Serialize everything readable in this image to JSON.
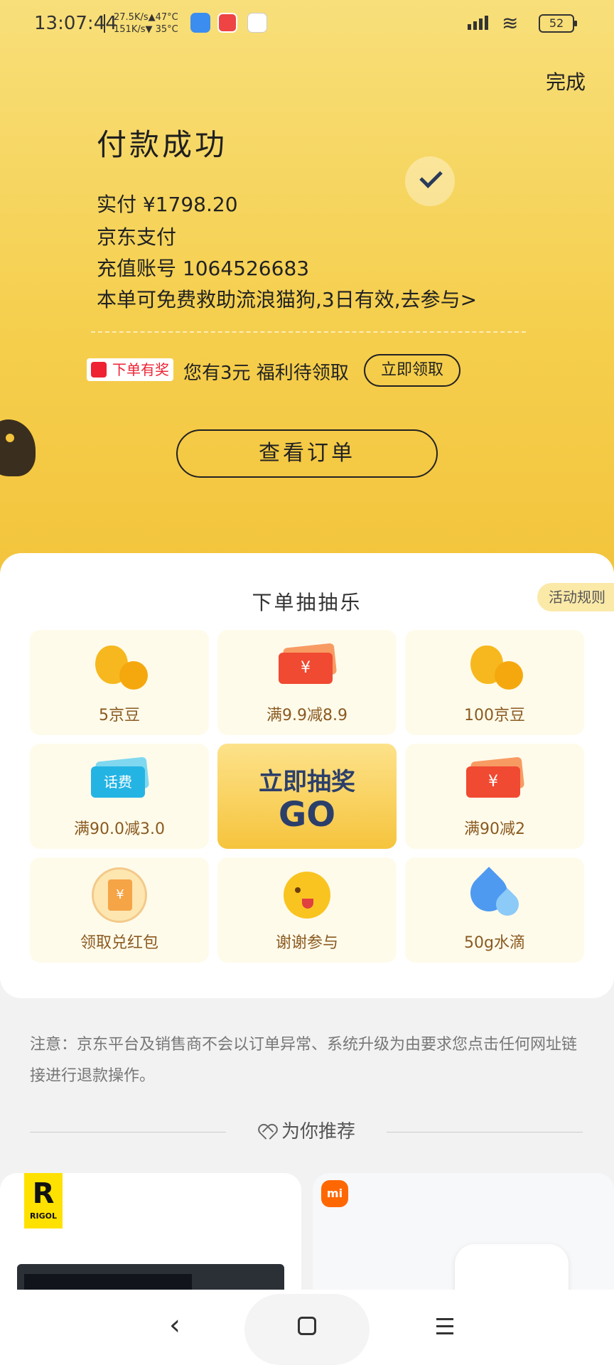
{
  "status_bar": {
    "time": "13:07:44",
    "net_up": "27.5K/s▲47°C",
    "net_down": "151K/s▼ 35°C",
    "battery": "52"
  },
  "header": {
    "done_label": "完成",
    "title": "付款成功"
  },
  "payment": {
    "paid_label": "实付",
    "paid_amount": "¥1798.20",
    "method": "京东支付",
    "account_label": "充值账号",
    "account_number": "1064526683",
    "rescue_text": "本单可免费救助流浪猫狗,3日有效,去参与>"
  },
  "reward": {
    "badge": "下单有奖",
    "welfare_text": "您有3元 福利待领取",
    "claim_button": "立即领取"
  },
  "order_button": "查看订单",
  "lottery": {
    "title": "下单抽抽乐",
    "rules_label": "活动规则",
    "go_line1": "立即抽奖",
    "go_line2": "GO",
    "phone_icon_text": "话费",
    "prizes": [
      {
        "label": "5京豆",
        "icon": "bean-icon"
      },
      {
        "label": "满9.9减8.9",
        "icon": "coupon-icon"
      },
      {
        "label": "100京豆",
        "icon": "bean-icon"
      },
      {
        "label": "满90.0减3.0",
        "icon": "phone-credit-icon"
      },
      {
        "label": "满90减2",
        "icon": "coupon-icon"
      },
      {
        "label": "领取兑红包",
        "icon": "red-packet-icon"
      },
      {
        "label": "谢谢参与",
        "icon": "wink-emoji-icon"
      },
      {
        "label": "50g水滴",
        "icon": "water-drop-icon"
      }
    ]
  },
  "notice": "注意：京东平台及销售商不会以订单异常、系统升级为由要求您点击任何网址链接进行退款操作。",
  "recommend": {
    "title": "为你推荐"
  },
  "products": {
    "brand1_letter": "R",
    "brand1_name": "RIGOL",
    "brand2_logo": "mi"
  },
  "colors": {
    "header_yellow": "#f5cf4e",
    "go_text": "#2c3f6b",
    "prize_text": "#8a5a20"
  }
}
